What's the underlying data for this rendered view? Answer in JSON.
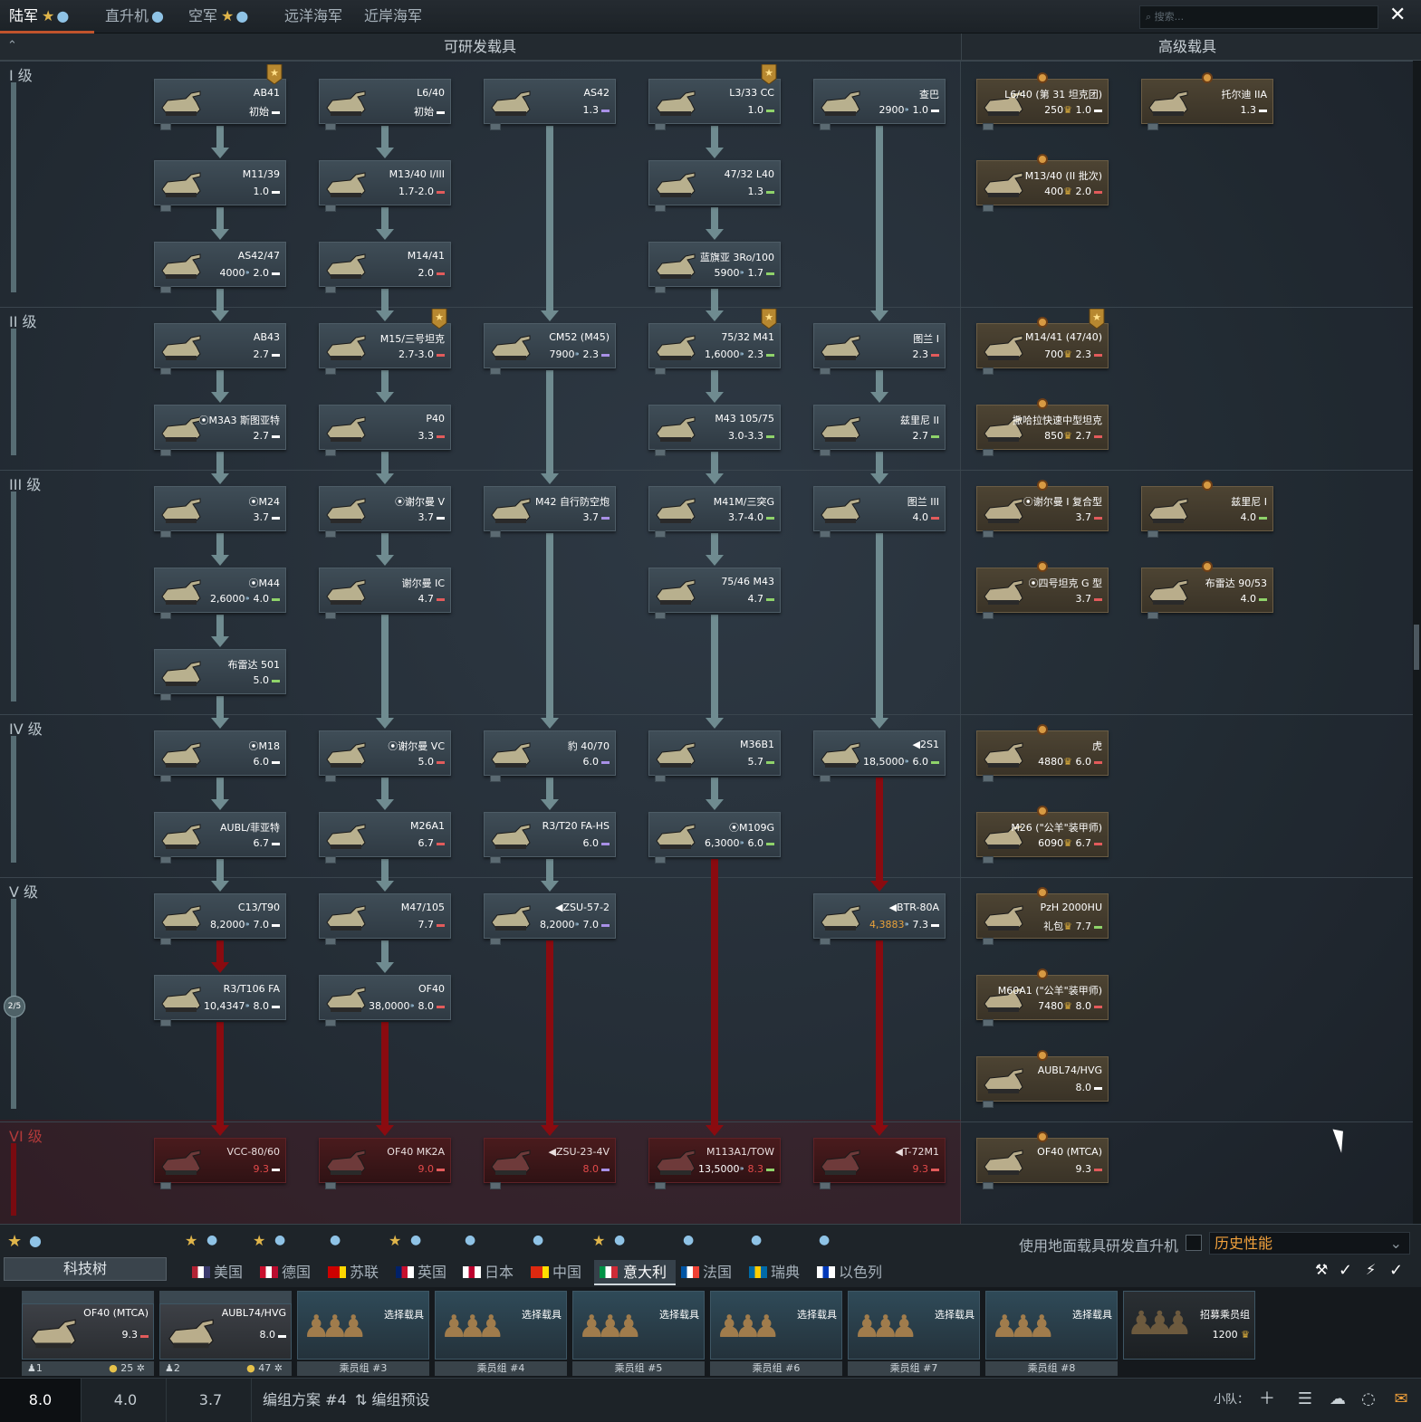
{
  "top_tabs": [
    {
      "label": "陆军",
      "active": true
    },
    {
      "label": "直升机",
      "active": false
    },
    {
      "label": "空军",
      "active": false
    },
    {
      "label": "远洋海军",
      "active": false
    },
    {
      "label": "近岸海军",
      "active": false
    }
  ],
  "search": {
    "placeholder": "搜索..."
  },
  "headers": {
    "researchable": "可研发载具",
    "premium": "高级载具"
  },
  "ranks": [
    "I 级",
    "II 级",
    "III 级",
    "IV 级",
    "V 级",
    "VI 级"
  ],
  "rank_progress": "2/5",
  "vehicles": {
    "c1": [
      {
        "name": "AB41",
        "br": "初始",
        "cls": "w"
      },
      {
        "name": "M11/39",
        "br": "1.0",
        "cls": "w"
      },
      {
        "name": "AS42/47",
        "rp": "4000",
        "br": "2.0",
        "cls": "w"
      },
      {
        "name": "AB43",
        "br": "2.7",
        "cls": "w"
      },
      {
        "name": "⦿M3A3 斯图亚特",
        "br": "2.7",
        "cls": "w"
      },
      {
        "name": "⦿M24",
        "br": "3.7",
        "cls": "w"
      },
      {
        "name": "⦿M44",
        "rp": "2,6000",
        "br": "4.0",
        "cls": "g"
      },
      {
        "name": "布雷达 501",
        "br": "5.0",
        "cls": "g"
      },
      {
        "name": "⦿M18",
        "br": "6.0",
        "cls": "w"
      },
      {
        "name": "AUBL/菲亚特",
        "br": "6.7",
        "cls": "w"
      },
      {
        "name": "C13/T90",
        "rp": "8,2000",
        "br": "7.0",
        "cls": "w"
      },
      {
        "name": "R3/T106 FA",
        "rp": "10,4347",
        "br": "8.0",
        "cls": "w"
      },
      {
        "name": "VCC-80/60",
        "br": "9.3",
        "cls": "w"
      }
    ],
    "c2": [
      {
        "name": "L6/40",
        "br": "初始",
        "cls": "w"
      },
      {
        "name": "M13/40 I/III",
        "br": "1.7-2.0",
        "cls": "r"
      },
      {
        "name": "M14/41",
        "br": "2.0",
        "cls": "r"
      },
      {
        "name": "M15/三号坦克",
        "br": "2.7-3.0",
        "cls": "r"
      },
      {
        "name": "P40",
        "br": "3.3",
        "cls": "r"
      },
      {
        "name": "⦿谢尔曼 V",
        "br": "3.7",
        "cls": "w"
      },
      {
        "name": "谢尔曼 IC",
        "br": "4.7",
        "cls": "r"
      },
      {
        "name": "⦿谢尔曼 VC",
        "br": "5.0",
        "cls": "r"
      },
      {
        "name": "M26A1",
        "br": "6.7",
        "cls": "r"
      },
      {
        "name": "M47/105",
        "br": "7.7",
        "cls": "r"
      },
      {
        "name": "OF40",
        "rp": "38,0000",
        "br": "8.0",
        "cls": "r"
      },
      {
        "name": "OF40 MK2A",
        "br": "9.0",
        "cls": "r"
      }
    ],
    "c3": [
      {
        "name": "AS42",
        "br": "1.3",
        "cls": "p"
      },
      {
        "name": "CM52 (M45)",
        "rp": "7900",
        "br": "2.3",
        "cls": "p"
      },
      {
        "name": "M42 自行防空炮",
        "br": "3.7",
        "cls": "p"
      },
      {
        "name": "豹 40/70",
        "br": "6.0",
        "cls": "p"
      },
      {
        "name": "R3/T20 FA-HS",
        "br": "6.0",
        "cls": "p"
      },
      {
        "name": "◀ZSU-57-2",
        "rp": "8,2000",
        "br": "7.0",
        "cls": "p"
      },
      {
        "name": "◀ZSU-23-4V",
        "br": "8.0",
        "cls": "p"
      }
    ],
    "c4": [
      {
        "name": "L3/33 CC",
        "br": "1.0",
        "cls": "g"
      },
      {
        "name": "47/32 L40",
        "br": "1.3",
        "cls": "g"
      },
      {
        "name": "蓝旗亚 3Ro/100",
        "rp": "5900",
        "br": "1.7",
        "cls": "g"
      },
      {
        "name": "75/32 M41",
        "rp": "1,6000",
        "br": "2.3",
        "cls": "g"
      },
      {
        "name": "M43 105/75",
        "br": "3.0-3.3",
        "cls": "g"
      },
      {
        "name": "M41M/三突G",
        "br": "3.7-4.0",
        "cls": "g"
      },
      {
        "name": "75/46 M43",
        "br": "4.7",
        "cls": "g"
      },
      {
        "name": "M36B1",
        "br": "5.7",
        "cls": "g"
      },
      {
        "name": "⦿M109G",
        "rp": "6,3000",
        "br": "6.0",
        "cls": "g"
      },
      {
        "name": "M113A1/TOW",
        "rp": "13,5000",
        "br": "8.3",
        "cls": "g"
      }
    ],
    "c5": [
      {
        "name": "查巴",
        "rp": "2900",
        "br": "1.0",
        "cls": "w"
      },
      {
        "name": "图兰 I",
        "br": "2.3",
        "cls": "r"
      },
      {
        "name": "兹里尼 II",
        "br": "2.7",
        "cls": "g"
      },
      {
        "name": "图兰 III",
        "br": "4.0",
        "cls": "r"
      },
      {
        "name": "◀2S1",
        "rp": "18,5000",
        "br": "6.0",
        "cls": "g"
      },
      {
        "name": "◀BTR-80A",
        "rp": "4,3883",
        "br": "7.3",
        "cls": "w"
      },
      {
        "name": "◀T-72M1",
        "br": "9.3",
        "cls": "r"
      }
    ],
    "premium": [
      {
        "name": "L6/40 (第 31 坦克团)",
        "rp": "250",
        "br": "1.0",
        "cls": "w"
      },
      {
        "name": "托尔迪 IIA",
        "br": "1.3",
        "cls": "w"
      },
      {
        "name": "M13/40 (II 批次)",
        "rp": "400",
        "br": "2.0",
        "cls": "r"
      },
      {
        "name": "M14/41 (47/40)",
        "rp": "700",
        "br": "2.3",
        "cls": "r"
      },
      {
        "name": "撒哈拉快速中型坦克",
        "rp": "850",
        "br": "2.7",
        "cls": "r"
      },
      {
        "name": "⦿谢尔曼 I 复合型",
        "br": "3.7",
        "cls": "r"
      },
      {
        "name": "兹里尼 I",
        "br": "4.0",
        "cls": "g"
      },
      {
        "name": "⦿四号坦克 G 型",
        "br": "3.7",
        "cls": "r"
      },
      {
        "name": "布雷达 90/53",
        "br": "4.0",
        "cls": "g"
      },
      {
        "name": "虎",
        "rp": "4880",
        "br": "6.0",
        "cls": "r"
      },
      {
        "name": "M26 (\"公羊\"装甲师)",
        "rp": "6090",
        "br": "6.7",
        "cls": "r"
      },
      {
        "name": "PzH 2000HU",
        "rp": "礼包",
        "br": "7.7",
        "cls": "g"
      },
      {
        "name": "M60A1 (\"公羊\"装甲师)",
        "rp": "7480",
        "br": "8.0",
        "cls": "r"
      },
      {
        "name": "AUBL74/HVG",
        "br": "8.0",
        "cls": "w"
      },
      {
        "name": "OF40 (MTCA)",
        "br": "9.3",
        "cls": "r"
      }
    ]
  },
  "heli_toggle_label": "使用地面载具研发直升机",
  "mode_select": "历史性能",
  "techtree_label": "科技树",
  "nations": [
    "美国",
    "德国",
    "苏联",
    "英国",
    "日本",
    "中国",
    "意大利",
    "法国",
    "瑞典",
    "以色列"
  ],
  "active_nation": "意大利",
  "crew_slots": [
    {
      "vehicle": "OF40 (MTCA)",
      "br": "9.3",
      "crew": "1",
      "level": "25"
    },
    {
      "vehicle": "AUBL74/HVG",
      "br": "8.0",
      "crew": "2",
      "level": "47"
    },
    {
      "select": "选择载具",
      "crew_label": "乘员组 #3"
    },
    {
      "select": "选择载具",
      "crew_label": "乘员组 #4"
    },
    {
      "select": "选择载具",
      "crew_label": "乘员组 #5"
    },
    {
      "select": "选择载具",
      "crew_label": "乘员组 #6"
    },
    {
      "select": "选择载具",
      "crew_label": "乘员组 #7"
    },
    {
      "select": "选择载具",
      "crew_label": "乘员组 #8"
    },
    {
      "recruit": "招募乘员组",
      "cost": "1200"
    }
  ],
  "status": {
    "br_tabs": [
      "8.0",
      "4.0",
      "3.7"
    ],
    "preset": "编组方案 #4",
    "preset_btn": "编组预设",
    "squad": "小队："
  },
  "colors": {
    "accent": "#c0532c",
    "locked": "#8a0b10",
    "premium": "#4d4433",
    "card": "#3f4d57"
  }
}
